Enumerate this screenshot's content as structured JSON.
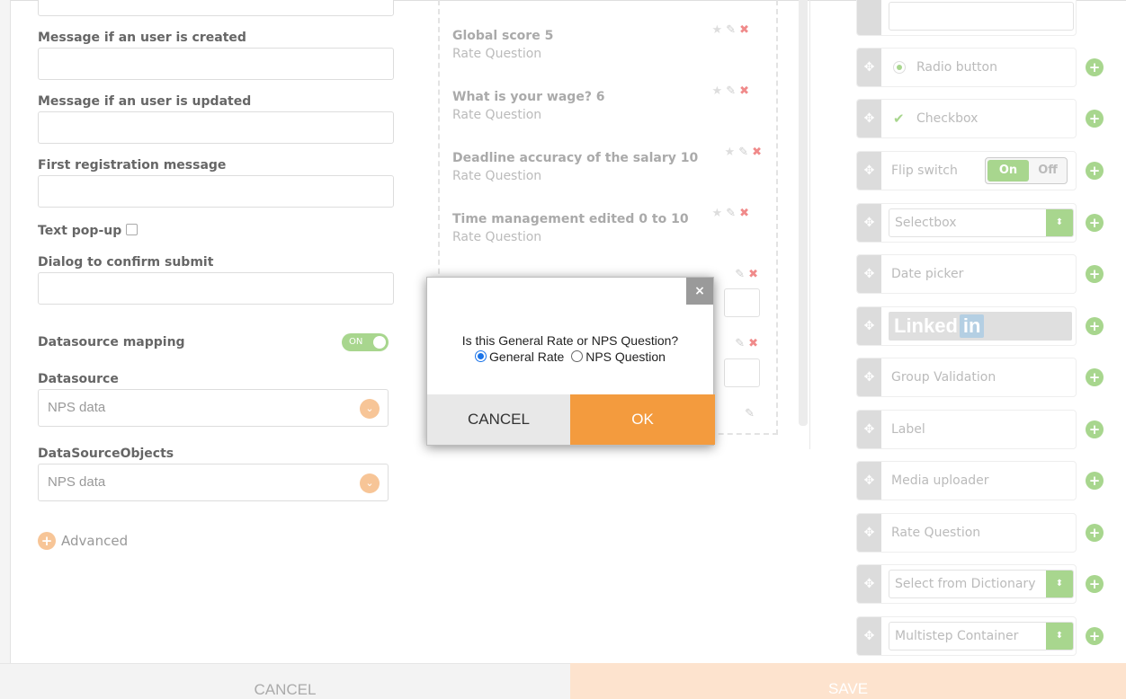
{
  "form": {
    "msg_created_label": "Message if an user is created",
    "msg_updated_label": "Message if an user is updated",
    "first_reg_label": "First registration message",
    "text_popup_label": "Text pop-up",
    "confirm_dialog_label": "Dialog to confirm submit",
    "ds_mapping_label": "Datasource mapping",
    "ds_mapping_toggle": "ON",
    "datasource_label": "Datasource",
    "datasource_value": "NPS data",
    "dso_label": "DataSourceObjects",
    "dso_value": "NPS data",
    "advanced_label": "Advanced",
    "advanced_icon": "+"
  },
  "questions": [
    {
      "title": "Global score 5",
      "type": "Rate Question"
    },
    {
      "title": "What is your wage? 6",
      "type": "Rate Question"
    },
    {
      "title": "Deadline accuracy of the salary 10",
      "type": "Rate Question"
    },
    {
      "title": "Time management edited 0 to 10",
      "type": "Rate Question"
    }
  ],
  "question_icons": {
    "star": "★",
    "edit": "✎",
    "delete": "✖"
  },
  "palette": {
    "radio": "Radio button",
    "checkbox": "Checkbox",
    "flip_label": "Flip switch",
    "flip_on": "On",
    "flip_off": "Off",
    "selectbox": "Selectbox",
    "datepicker": "Date picker",
    "linkedin_text": "Linked",
    "linkedin_in": "in",
    "group_validation": "Group Validation",
    "label": "Label",
    "media_uploader": "Media uploader",
    "rate_question": "Rate Question",
    "select_dictionary": "Select from Dictionary",
    "multistep": "Multistep Container",
    "handle_icon": "✥",
    "add_icon": "+",
    "check_icon": "✔",
    "spinner_icon": "⬍"
  },
  "modal": {
    "question": "Is this General Rate or NPS Question?",
    "option_general": "General Rate",
    "option_nps": "NPS Question",
    "cancel": "CANCEL",
    "ok": "OK",
    "close_icon": "×",
    "selected": "General Rate"
  },
  "footer": {
    "cancel": "CANCEL",
    "save": "SAVE"
  },
  "colors": {
    "accent_orange": "#f39b3e",
    "accent_green": "#a8d68e",
    "radio_selected": "#1a73e8"
  }
}
